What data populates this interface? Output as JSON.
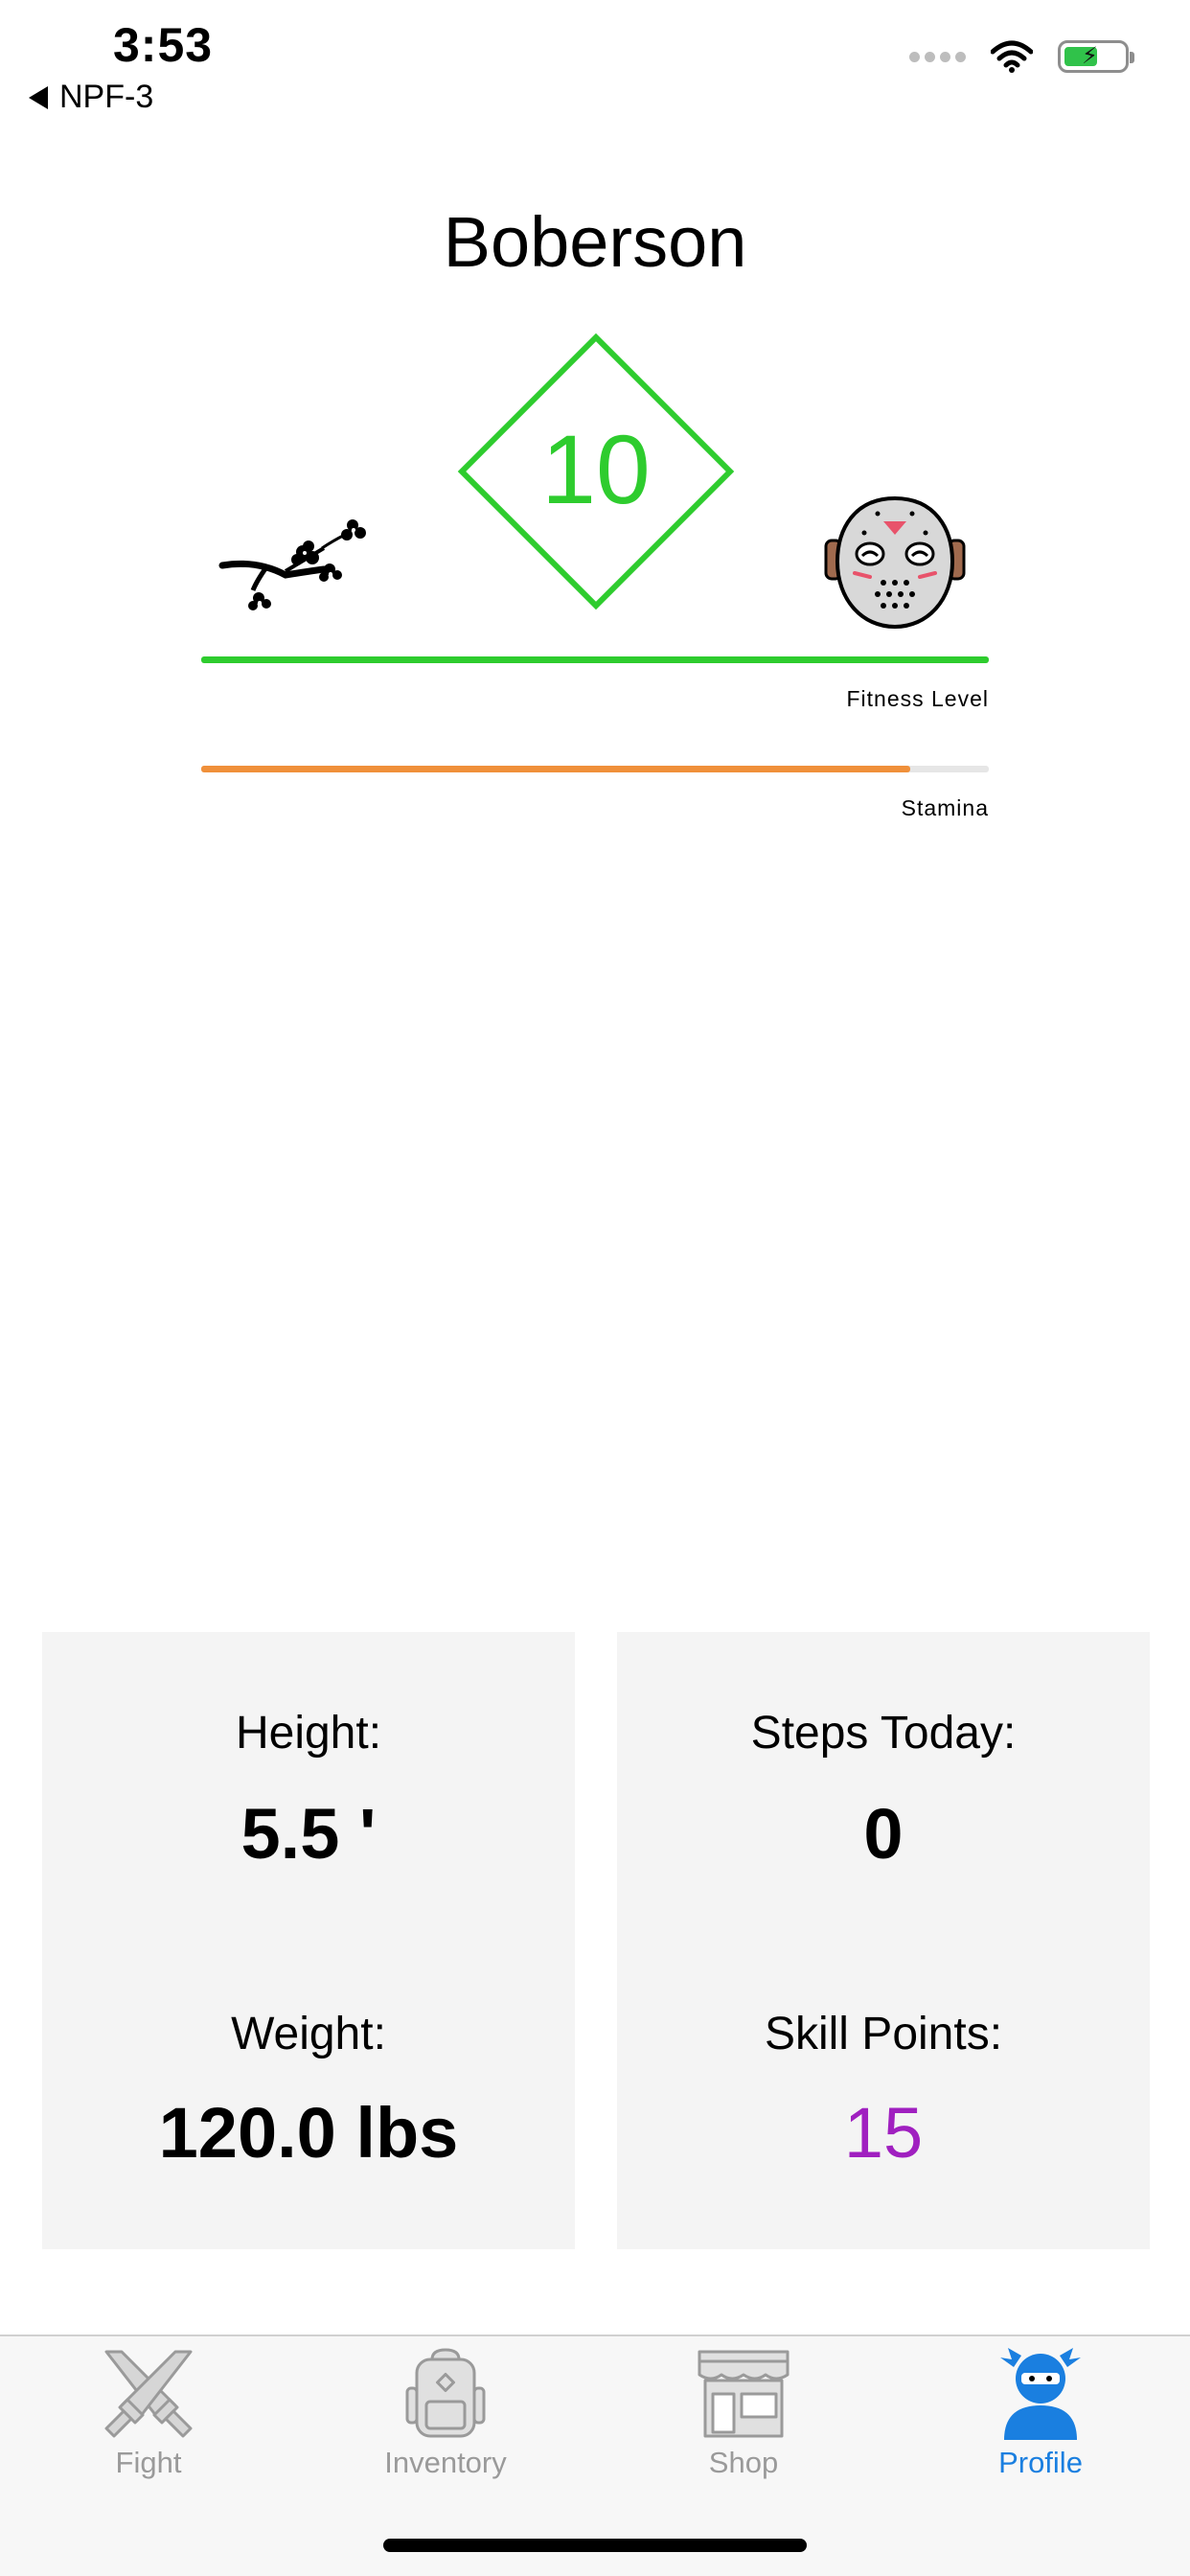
{
  "status_bar": {
    "time": "3:53",
    "back_label": "NPF-3",
    "battery_level": 0.6
  },
  "profile": {
    "username": "Boberson",
    "level": "10",
    "fitness_level_label": "Fitness Level",
    "fitness_level_fraction": 1.0,
    "stamina_label": "Stamina",
    "stamina_fraction": 0.9,
    "left_icon": "cherry-blossom-branch-icon",
    "right_icon": "hockey-mask-icon"
  },
  "stats": {
    "height_label": "Height:",
    "height_value": "5.5 '",
    "weight_label": "Weight:",
    "weight_value": "120.0 lbs",
    "steps_label": "Steps Today:",
    "steps_value": "0",
    "skill_label": "Skill Points:",
    "skill_value": "15"
  },
  "tabs": [
    {
      "label": "Fight",
      "icon": "crossed-swords-icon",
      "active": false
    },
    {
      "label": "Inventory",
      "icon": "backpack-icon",
      "active": false
    },
    {
      "label": "Shop",
      "icon": "storefront-icon",
      "active": false
    },
    {
      "label": "Profile",
      "icon": "ninja-icon",
      "active": true
    }
  ],
  "colors": {
    "level_green": "#2ecc2e",
    "stamina_orange": "#f0903a",
    "skill_purple": "#a020c0",
    "tab_active": "#1a7fe0",
    "tab_inactive": "#9a9a9a"
  }
}
